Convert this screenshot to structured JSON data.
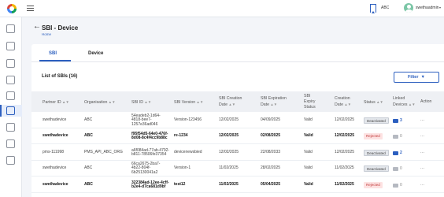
{
  "topbar": {
    "partner_label": "ABC",
    "username": "swethaadmin",
    "caret": "▾"
  },
  "header": {
    "back": "←",
    "title": "SBI - Device",
    "breadcrumb": "Home"
  },
  "tabs": [
    {
      "label": "SBI"
    },
    {
      "label": "Device"
    }
  ],
  "list": {
    "title": "List of SBIs (16)",
    "filter_label": "Filter",
    "filter_caret": "▼"
  },
  "table": {
    "columns": [
      {
        "label": "Partner ID",
        "sort": "▲▼"
      },
      {
        "label": "Organisation",
        "sort": "▲▼"
      },
      {
        "label": "SBI ID",
        "sort": "▲▼"
      },
      {
        "label": "SBI Version",
        "sort": "▲▼"
      },
      {
        "label": "SBI Creation\nDate",
        "sort": "▲▼"
      },
      {
        "label": "SBI Expiration\nDate",
        "sort": "▲▼"
      },
      {
        "label": "SBI\nExpiry\nStatus",
        "sort": ""
      },
      {
        "label": "Creation\nDate",
        "sort": "▲▼"
      },
      {
        "label": "Status",
        "sort": "▲▼"
      },
      {
        "label": "Linked\nDevices",
        "sort": "▲▼"
      },
      {
        "label": "Action",
        "sort": ""
      }
    ],
    "rows": [
      {
        "partner_id": "swethadevice",
        "org": "ABC",
        "sbi_id": "54eadeb2-1d64-\n4818-bee7-\n1257e36ad046",
        "version": "Version-123456",
        "sbi_created": "12/02/2025",
        "sbi_expires": "04/09/2025",
        "expiry_status": "Valid",
        "created": "12/02/2025",
        "status": "Deactivated",
        "status_type": "deactivated",
        "devices": "3",
        "devices_type": "active",
        "action": "···",
        "bold": false
      },
      {
        "partner_id": "swethadevice",
        "org": "ABC",
        "sbi_id": "f95f54d5-64e0-476f-\n8d08-8c4f4cc9b88c",
        "version": "re-1234",
        "sbi_created": "12/02/2025",
        "sbi_expires": "02/08/2025",
        "expiry_status": "Valid",
        "created": "12/02/2025",
        "status": "Rejected",
        "status_type": "rejected",
        "devices": "0",
        "devices_type": "inactive",
        "action": "···",
        "bold": true
      },
      {
        "partner_id": "pms-111998",
        "org": "PMS_API_ABC_ORG",
        "sbi_id": "a6f084ad-77ab-4792-\nb811-78506fe37354",
        "version": "devicenewsbied",
        "sbi_created": "12/02/2025",
        "sbi_expires": "22/08/2033",
        "expiry_status": "Valid",
        "created": "12/02/2025",
        "status": "Deactivated",
        "status_type": "deactivated",
        "devices": "2",
        "devices_type": "active",
        "action": "···",
        "bold": false
      },
      {
        "partner_id": "swethadevice",
        "org": "ABC",
        "sbi_id": "66ca2675-2ba7-\n4b22-804f-\n6b25130041a2",
        "version": "Version-1",
        "sbi_created": "11/02/2025",
        "sbi_expires": "28/02/2025",
        "expiry_status": "Valid",
        "created": "11/02/2025",
        "status": "Deactivated",
        "status_type": "deactivated",
        "devices": "0",
        "devices_type": "inactive",
        "action": "···",
        "bold": false
      },
      {
        "partner_id": "swethadevice",
        "org": "ABC",
        "sbi_id": "322384ad-12ee-4cff-\nb2e4-d7ca681d9bf",
        "version": "test12",
        "sbi_created": "11/02/2025",
        "sbi_expires": "05/04/2025",
        "expiry_status": "Valid",
        "created": "11/02/2025",
        "status": "Rejected",
        "status_type": "rejected",
        "devices": "0",
        "devices_type": "inactive",
        "action": "···",
        "bold": true
      }
    ]
  },
  "colors": {
    "accent": "#2c5fbf",
    "background": "#f3f5f9"
  },
  "icons": [
    "logo-icon",
    "menu-icon",
    "bookmark-icon",
    "avatar",
    "home-icon",
    "document-icon",
    "partner-icon",
    "policy-icon",
    "certificate-icon",
    "sbi-device-icon",
    "ftm-icon",
    "report-icon",
    "security-icon"
  ]
}
